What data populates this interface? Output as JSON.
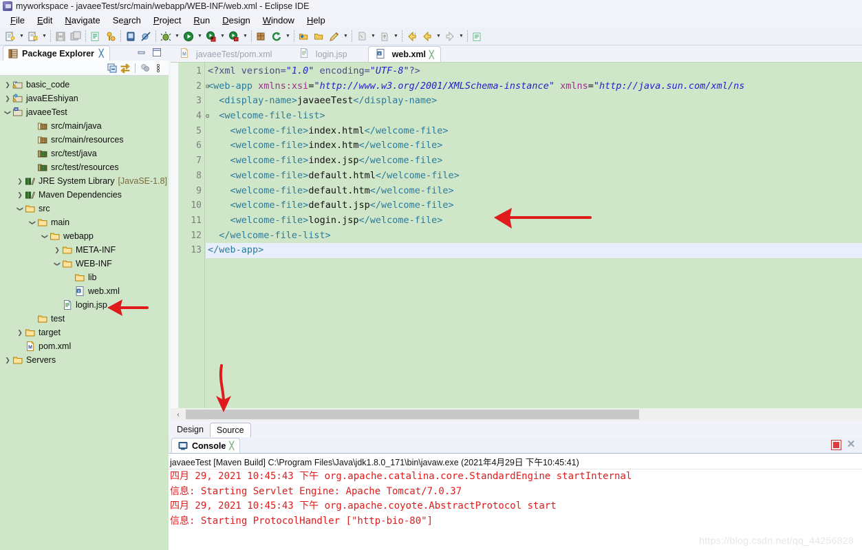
{
  "window": {
    "title": "myworkspace - javaeeTest/src/main/webapp/WEB-INF/web.xml - Eclipse IDE",
    "icon": "eclipse-icon"
  },
  "menubar": {
    "items": [
      {
        "label": "File",
        "mnemonic": "F"
      },
      {
        "label": "Edit",
        "mnemonic": "E"
      },
      {
        "label": "Navigate",
        "mnemonic": "N"
      },
      {
        "label": "Search",
        "mnemonic": "a"
      },
      {
        "label": "Project",
        "mnemonic": "P"
      },
      {
        "label": "Run",
        "mnemonic": "R"
      },
      {
        "label": "Design",
        "mnemonic": "D"
      },
      {
        "label": "Window",
        "mnemonic": "W"
      },
      {
        "label": "Help",
        "mnemonic": "H"
      }
    ]
  },
  "toolbar": {
    "buttons": [
      {
        "name": "new-wizard-icon",
        "dropdown": true
      },
      {
        "name": "new-java-project-icon",
        "dropdown": true
      },
      {
        "name": "save-icon",
        "dropdown": false
      },
      {
        "name": "save-all-icon",
        "dropdown": false
      },
      {
        "name": "open-type-icon",
        "dropdown": false
      },
      {
        "name": "link-editor-icon",
        "dropdown": false
      },
      {
        "name": "open-task-icon",
        "dropdown": false
      },
      {
        "name": "skip-breakpoints-icon",
        "dropdown": false
      },
      {
        "name": "debug-icon",
        "dropdown": true
      },
      {
        "name": "run-icon",
        "dropdown": true
      },
      {
        "name": "coverage-icon",
        "dropdown": true
      },
      {
        "name": "profile-icon",
        "dropdown": true
      },
      {
        "name": "new-package-icon",
        "dropdown": false
      },
      {
        "name": "refresh-icon",
        "dropdown": true
      },
      {
        "name": "open-resource-icon",
        "dropdown": false
      },
      {
        "name": "open-folder-icon",
        "dropdown": false
      },
      {
        "name": "edit-icon",
        "dropdown": true
      },
      {
        "name": "annotation-icon",
        "dropdown": true
      },
      {
        "name": "up-navigate-icon",
        "dropdown": true
      },
      {
        "name": "back-icon",
        "dropdown": false
      },
      {
        "name": "previous-icon",
        "dropdown": true
      },
      {
        "name": "forward-icon",
        "dropdown": true
      },
      {
        "name": "new-editor-icon",
        "dropdown": false
      }
    ]
  },
  "package_explorer": {
    "tab_label": "Package Explorer",
    "close_glyph": "╳",
    "view_tools": [
      {
        "name": "collapse-all-icon"
      },
      {
        "name": "link-with-editor-icon"
      },
      {
        "name": "view-menu-icon"
      },
      {
        "name": "view-overflow-icon"
      }
    ],
    "tree": [
      {
        "label": "basic_code",
        "indent": 0,
        "twist": "collapsed",
        "icon": "java-project-warning-icon"
      },
      {
        "label": "javaEEshiyan",
        "indent": 0,
        "twist": "collapsed",
        "icon": "web-project-warning-icon"
      },
      {
        "label": "javaeeTest",
        "indent": 0,
        "twist": "expanded",
        "icon": "maven-project-icon"
      },
      {
        "label": "src/main/java",
        "indent": 2,
        "twist": "none",
        "icon": "source-folder-empty-icon"
      },
      {
        "label": "src/main/resources",
        "indent": 2,
        "twist": "none",
        "icon": "source-folder-empty-icon"
      },
      {
        "label": "src/test/java",
        "indent": 2,
        "twist": "none",
        "icon": "source-folder-icon"
      },
      {
        "label": "src/test/resources",
        "indent": 2,
        "twist": "none",
        "icon": "source-folder-icon"
      },
      {
        "label": "JRE System Library",
        "suffix": "[JavaSE-1.8]",
        "indent": 1,
        "twist": "collapsed",
        "icon": "library-icon"
      },
      {
        "label": "Maven Dependencies",
        "indent": 1,
        "twist": "collapsed",
        "icon": "library-icon"
      },
      {
        "label": "src",
        "indent": 1,
        "twist": "expanded",
        "icon": "folder-icon"
      },
      {
        "label": "main",
        "indent": 2,
        "twist": "expanded",
        "icon": "folder-icon"
      },
      {
        "label": "webapp",
        "indent": 3,
        "twist": "expanded",
        "icon": "folder-icon"
      },
      {
        "label": "META-INF",
        "indent": 4,
        "twist": "collapsed",
        "icon": "folder-icon"
      },
      {
        "label": "WEB-INF",
        "indent": 4,
        "twist": "expanded",
        "icon": "folder-icon"
      },
      {
        "label": "lib",
        "indent": 5,
        "twist": "none",
        "icon": "folder-icon"
      },
      {
        "label": "web.xml",
        "indent": 5,
        "twist": "none",
        "icon": "xml-file-icon"
      },
      {
        "label": "login.jsp",
        "indent": 4,
        "twist": "none",
        "icon": "jsp-file-icon"
      },
      {
        "label": "test",
        "indent": 2,
        "twist": "none",
        "icon": "folder-icon"
      },
      {
        "label": "target",
        "indent": 1,
        "twist": "collapsed",
        "icon": "folder-icon"
      },
      {
        "label": "pom.xml",
        "indent": 1,
        "twist": "none",
        "icon": "maven-pom-icon"
      },
      {
        "label": "Servers",
        "indent": 0,
        "twist": "collapsed",
        "icon": "folder-icon"
      }
    ]
  },
  "editor": {
    "tabs": [
      {
        "label": "javaeeTest/pom.xml",
        "icon": "maven-pom-icon",
        "active": false,
        "closeable": false
      },
      {
        "label": "login.jsp",
        "icon": "jsp-file-icon",
        "active": false,
        "closeable": false
      },
      {
        "label": "web.xml",
        "icon": "xml-file-icon",
        "active": true,
        "closeable": true,
        "close_glyph": "╳"
      }
    ],
    "current_line": 13,
    "lines": [
      {
        "n": 1,
        "fold": "",
        "tokens": [
          {
            "t": "<?xml version=",
            "c": "pi"
          },
          {
            "t": "\"1.0\"",
            "c": "val"
          },
          {
            "t": " encoding=",
            "c": "pi"
          },
          {
            "t": "\"UTF-8\"",
            "c": "val"
          },
          {
            "t": "?>",
            "c": "pi"
          }
        ]
      },
      {
        "n": 2,
        "fold": "⊟",
        "tokens": [
          {
            "t": "<web-app",
            "c": "tag"
          },
          {
            "t": " xmlns:xsi",
            "c": "attr"
          },
          {
            "t": "=",
            "c": "eq"
          },
          {
            "t": "\"http://www.w3.org/2001/XMLSchema-instance\"",
            "c": "val"
          },
          {
            "t": " xmlns",
            "c": "attr"
          },
          {
            "t": "=",
            "c": "eq"
          },
          {
            "t": "\"http://java.sun.com/xml/ns",
            "c": "val"
          }
        ]
      },
      {
        "n": 3,
        "fold": "",
        "tokens": [
          {
            "t": "  <display-name>",
            "c": "tag"
          },
          {
            "t": "javaeeTest",
            "c": "text"
          },
          {
            "t": "</display-name>",
            "c": "tag"
          }
        ]
      },
      {
        "n": 4,
        "fold": "⊟",
        "tokens": [
          {
            "t": "  <welcome-file-list>",
            "c": "tag"
          }
        ]
      },
      {
        "n": 5,
        "fold": "",
        "tokens": [
          {
            "t": "    <welcome-file>",
            "c": "tag"
          },
          {
            "t": "index.html",
            "c": "text"
          },
          {
            "t": "</welcome-file>",
            "c": "tag"
          }
        ]
      },
      {
        "n": 6,
        "fold": "",
        "tokens": [
          {
            "t": "    <welcome-file>",
            "c": "tag"
          },
          {
            "t": "index.htm",
            "c": "text"
          },
          {
            "t": "</welcome-file>",
            "c": "tag"
          }
        ]
      },
      {
        "n": 7,
        "fold": "",
        "tokens": [
          {
            "t": "    <welcome-file>",
            "c": "tag"
          },
          {
            "t": "index.jsp",
            "c": "text"
          },
          {
            "t": "</welcome-file>",
            "c": "tag"
          }
        ]
      },
      {
        "n": 8,
        "fold": "",
        "tokens": [
          {
            "t": "    <welcome-file>",
            "c": "tag"
          },
          {
            "t": "default.html",
            "c": "text"
          },
          {
            "t": "</welcome-file>",
            "c": "tag"
          }
        ]
      },
      {
        "n": 9,
        "fold": "",
        "tokens": [
          {
            "t": "    <welcome-file>",
            "c": "tag"
          },
          {
            "t": "default.htm",
            "c": "text"
          },
          {
            "t": "</welcome-file>",
            "c": "tag"
          }
        ]
      },
      {
        "n": 10,
        "fold": "",
        "tokens": [
          {
            "t": "    <welcome-file>",
            "c": "tag"
          },
          {
            "t": "default.jsp",
            "c": "text"
          },
          {
            "t": "</welcome-file>",
            "c": "tag"
          }
        ]
      },
      {
        "n": 11,
        "fold": "",
        "tokens": [
          {
            "t": "    <welcome-file>",
            "c": "tag"
          },
          {
            "t": "login.jsp",
            "c": "text"
          },
          {
            "t": "</welcome-file>",
            "c": "tag"
          }
        ]
      },
      {
        "n": 12,
        "fold": "",
        "tokens": [
          {
            "t": "  </welcome-file-list>",
            "c": "tag"
          }
        ]
      },
      {
        "n": 13,
        "fold": "",
        "tokens": [
          {
            "t": "</web-app>",
            "c": "tag"
          }
        ]
      }
    ],
    "bottom_tabs": [
      {
        "label": "Design",
        "selected": false
      },
      {
        "label": "Source",
        "selected": true
      }
    ],
    "hscroll_left_glyph": "‹"
  },
  "console": {
    "tab_label": "Console",
    "close_glyph": "╳",
    "stop_button": "stop-icon",
    "close_button": "close-icon",
    "header": "javaeeTest [Maven Build] C:\\Program Files\\Java\\jdk1.8.0_171\\bin\\javaw.exe (2021年4月29日 下午10:45:41)",
    "lines": [
      "四月 29, 2021 10:45:43 下午 org.apache.catalina.core.StandardEngine startInternal",
      "信息: Starting Servlet Engine: Apache Tomcat/7.0.37",
      "四月 29, 2021 10:45:43 下午 org.apache.coyote.AbstractProtocol start",
      "信息: Starting ProtocolHandler [\"http-bio-80\"]"
    ]
  },
  "watermark": "https://blog.csdn.net/qq_44256828",
  "colors": {
    "editor_background": "#cfe6c8",
    "tree_background": "#cfe6c8",
    "current_line": "#e8eefb",
    "console_text": "#e01b1b",
    "annotation_arrow": "#e01b1b",
    "tag": "#2a7a9b",
    "attribute": "#9b2d8f",
    "value": "#2222cc"
  }
}
